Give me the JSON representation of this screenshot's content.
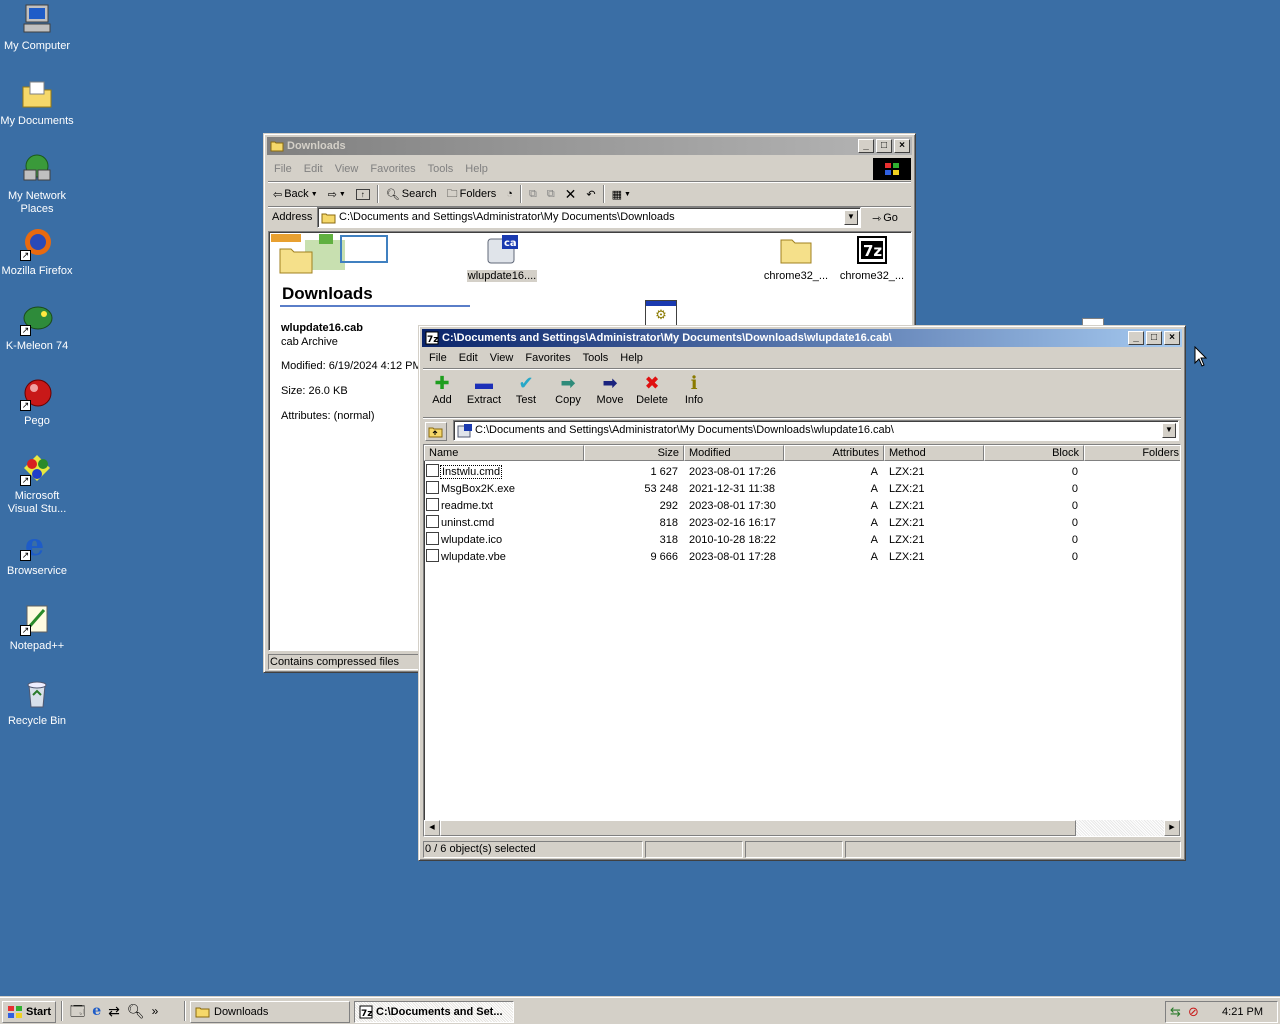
{
  "desktop": {
    "icons": [
      {
        "label": "My Computer",
        "icon": "computer-icon"
      },
      {
        "label": "My Documents",
        "icon": "folder-documents-icon"
      },
      {
        "label": "My Network Places",
        "icon": "network-icon"
      },
      {
        "label": "Mozilla Firefox",
        "icon": "firefox-icon"
      },
      {
        "label": "K-Meleon 74",
        "icon": "kmeleon-icon"
      },
      {
        "label": "Pego",
        "icon": "pego-icon"
      },
      {
        "label": "Microsoft Visual Stu...",
        "icon": "visual-studio-icon"
      },
      {
        "label": "Browservice",
        "icon": "browservice-icon"
      },
      {
        "label": "Notepad++",
        "icon": "notepadpp-icon"
      },
      {
        "label": "Recycle Bin",
        "icon": "recycle-bin-icon"
      }
    ]
  },
  "explorer": {
    "title": "Downloads",
    "menu": [
      "File",
      "Edit",
      "View",
      "Favorites",
      "Tools",
      "Help"
    ],
    "toolbar": {
      "back": "Back",
      "search": "Search",
      "folders": "Folders"
    },
    "address_label": "Address",
    "address_value": "C:\\Documents and Settings\\Administrator\\My Documents\\Downloads",
    "go_label": "Go",
    "panel_title": "Downloads",
    "details": {
      "name": "wlupdate16.cab",
      "type": "cab Archive",
      "modified": "Modified: 6/19/2024 4:12 PM",
      "size": "Size: 26.0 KB",
      "attributes": "Attributes: (normal)"
    },
    "files": [
      {
        "label": "wlupdate16....",
        "icon": "cab-file-icon"
      },
      {
        "label": "chrome32_...",
        "icon": "folder-icon"
      },
      {
        "label": "chrome32_...",
        "icon": "7z-file-icon"
      }
    ],
    "status": "Contains compressed files"
  },
  "sevenzip": {
    "title": "C:\\Documents and Settings\\Administrator\\My Documents\\Downloads\\wlupdate16.cab\\",
    "menu": [
      "File",
      "Edit",
      "View",
      "Favorites",
      "Tools",
      "Help"
    ],
    "toolbar": [
      {
        "label": "Add",
        "glyph": "✚",
        "color": "#1e9e1e",
        "icon": "add-icon"
      },
      {
        "label": "Extract",
        "glyph": "▬",
        "color": "#1c2fb8",
        "icon": "extract-icon"
      },
      {
        "label": "Test",
        "glyph": "✔",
        "color": "#28a8c8",
        "icon": "test-icon"
      },
      {
        "label": "Copy",
        "glyph": "➡",
        "color": "#2e8b7a",
        "icon": "copy-icon"
      },
      {
        "label": "Move",
        "glyph": "➡",
        "color": "#1a237e",
        "icon": "move-icon"
      },
      {
        "label": "Delete",
        "glyph": "✖",
        "color": "#e01010",
        "icon": "delete-icon"
      },
      {
        "label": "Info",
        "glyph": "ℹ",
        "color": "#8a7a00",
        "icon": "info-icon"
      }
    ],
    "path": "C:\\Documents and Settings\\Administrator\\My Documents\\Downloads\\wlupdate16.cab\\",
    "columns": [
      "Name",
      "Size",
      "Modified",
      "Attributes",
      "Method",
      "Block",
      "Folders"
    ],
    "rows": [
      {
        "name": "Instwlu.cmd",
        "size": "1 627",
        "modified": "2023-08-01 17:26",
        "attributes": "A",
        "method": "LZX:21",
        "block": "0"
      },
      {
        "name": "MsgBox2K.exe",
        "size": "53 248",
        "modified": "2021-12-31 11:38",
        "attributes": "A",
        "method": "LZX:21",
        "block": "0"
      },
      {
        "name": "readme.txt",
        "size": "292",
        "modified": "2023-08-01 17:30",
        "attributes": "A",
        "method": "LZX:21",
        "block": "0"
      },
      {
        "name": "uninst.cmd",
        "size": "818",
        "modified": "2023-02-16 16:17",
        "attributes": "A",
        "method": "LZX:21",
        "block": "0"
      },
      {
        "name": "wlupdate.ico",
        "size": "318",
        "modified": "2010-10-28 18:22",
        "attributes": "A",
        "method": "LZX:21",
        "block": "0"
      },
      {
        "name": "wlupdate.vbe",
        "size": "9 666",
        "modified": "2023-08-01 17:28",
        "attributes": "A",
        "method": "LZX:21",
        "block": "0"
      }
    ],
    "status": "0 / 6 object(s) selected"
  },
  "taskbar": {
    "start": "Start",
    "tasks": [
      "Downloads",
      "C:\\Documents and Set..."
    ],
    "chevron": "»",
    "clock": "4:21 PM"
  }
}
